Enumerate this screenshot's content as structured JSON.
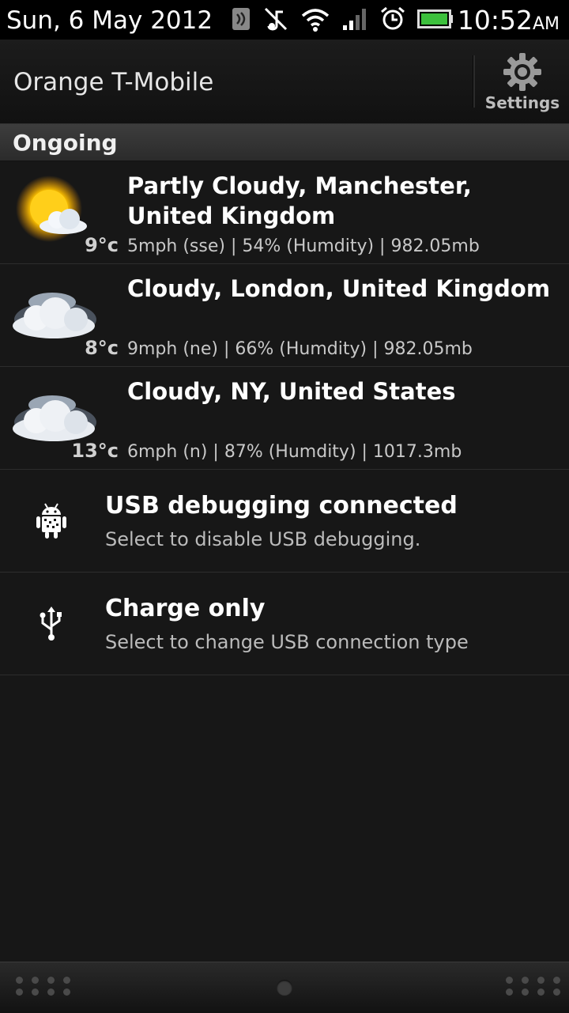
{
  "status_bar": {
    "date": "Sun, 6 May 2012",
    "time": "10:52",
    "ampm": "AM",
    "icons": [
      "nfc-icon",
      "mute-icon",
      "wifi-icon",
      "signal-icon",
      "alarm-icon",
      "battery-icon"
    ],
    "battery_color": "#3cc03c"
  },
  "header": {
    "carrier": "Orange T-Mobile",
    "settings_label": "Settings"
  },
  "section": {
    "title": "Ongoing"
  },
  "weather": [
    {
      "icon": "partly-cloudy-icon",
      "temp": "9°c",
      "title": "Partly Cloudy, Manchester, United Kingdom",
      "detail": "5mph (sse)  | 54% (Humdity) | 982.05mb"
    },
    {
      "icon": "cloudy-icon",
      "temp": "8°c",
      "title": "Cloudy, London, United Kingdom",
      "detail": "9mph (ne)  | 66% (Humdity) | 982.05mb"
    },
    {
      "icon": "cloudy-icon",
      "temp": "13°c",
      "title": "Cloudy, NY, United States",
      "detail": "6mph (n)  | 87% (Humdity) | 1017.3mb"
    }
  ],
  "notifications": [
    {
      "icon": "android-debug-icon",
      "title": "USB debugging connected",
      "subtitle": "Select to disable USB debugging."
    },
    {
      "icon": "usb-icon",
      "title": "Charge only",
      "subtitle": "Select to change USB connection type"
    }
  ]
}
